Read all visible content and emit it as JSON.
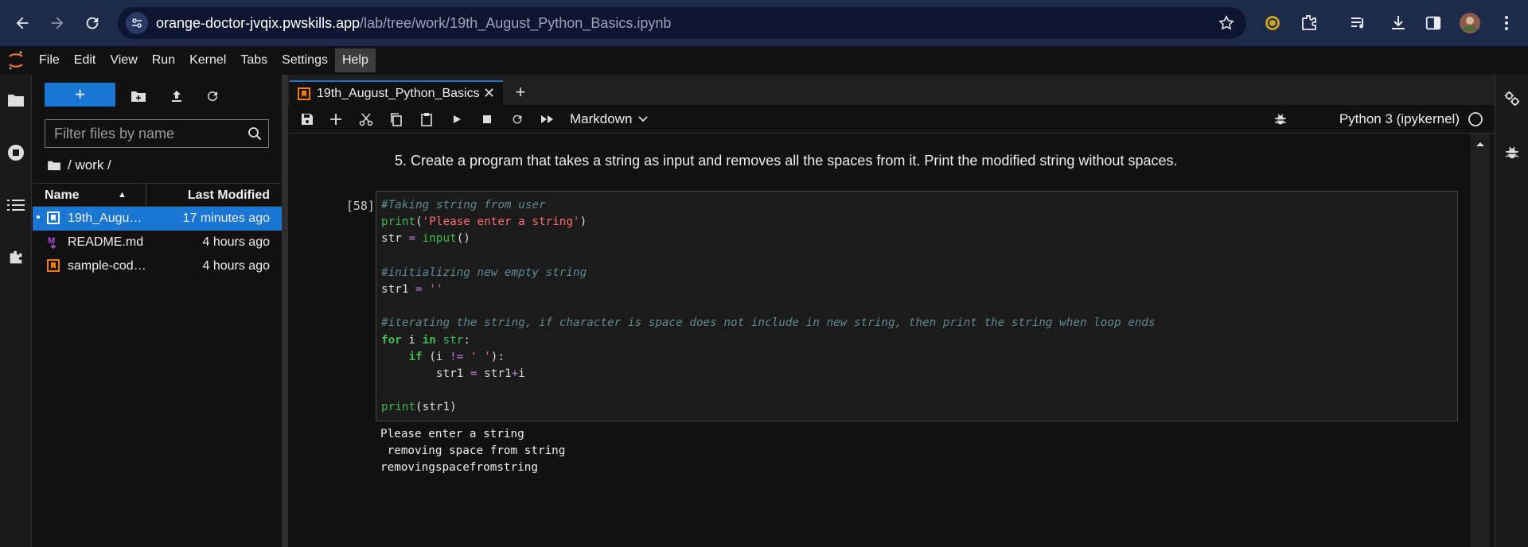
{
  "browser": {
    "url_host": "orange-doctor-jvqix.pwskills.app",
    "url_path": "/lab/tree/work/19th_August_Python_Basics.ipynb"
  },
  "menu": [
    "File",
    "Edit",
    "View",
    "Run",
    "Kernel",
    "Tabs",
    "Settings",
    "Help"
  ],
  "active_menu": "Help",
  "filebrowser": {
    "filter_placeholder": "Filter files by name",
    "breadcrumb": "/ work /",
    "col_name": "Name",
    "col_modified": "Last Modified",
    "files": [
      {
        "name": "19th_August_Python_Basics.ipynb",
        "modified": "17 minutes ago",
        "type": "notebook",
        "selected": true
      },
      {
        "name": "README.md",
        "modified": "4 hours ago",
        "type": "markdown",
        "selected": false
      },
      {
        "name": "sample-code.ipynb",
        "modified": "4 hours ago",
        "type": "notebook",
        "selected": false
      }
    ]
  },
  "tab": {
    "title": "19th_August_Python_Basics.ipynb"
  },
  "toolbar": {
    "cell_type": "Markdown",
    "kernel_name": "Python 3 (ipykernel)"
  },
  "notebook": {
    "markdown_text": "5. Create a program that takes a string as input and removes all the spaces from it. Print the modified string without spaces.",
    "prompt": "[58]:",
    "output_lines": [
      "Please enter a string",
      " removing space from string",
      "removingspacefromstring"
    ]
  },
  "colors": {
    "accent": "#1976d2",
    "notebook_icon": "#f57c00",
    "markdown_icon": "#9c27b0"
  }
}
